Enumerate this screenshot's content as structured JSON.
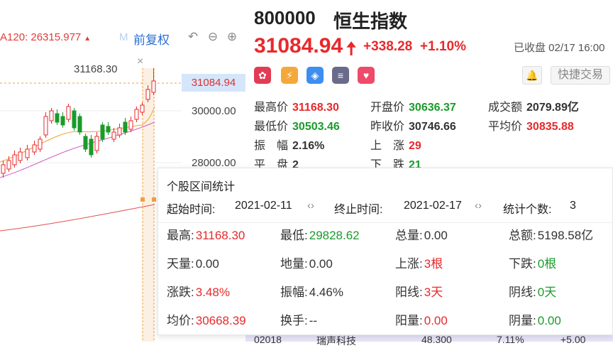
{
  "chart": {
    "ma_label": "A120: 26315.977",
    "ma_arrow": "▲",
    "ma_m": "M",
    "fuquan": "前复权",
    "high_label": "31168.30",
    "current_tag": "31084.94",
    "axis_labels": [
      "30000.00",
      "28000.00"
    ],
    "close_icon": "×",
    "tool_icons": [
      "undo-icon",
      "zoom-out-icon",
      "zoom-in-icon"
    ]
  },
  "info": {
    "code": "800000",
    "name": "恒生指数",
    "price": "31084.94",
    "change": "+338.28",
    "change_pct": "+1.10%",
    "status": "已收盘 02/17 16:00",
    "quick_trade": "快捷交易",
    "badge_colors": [
      "#e23b54",
      "#f4a83a",
      "#3d8ef0",
      "#6a6a8a",
      "#ee4a6a"
    ],
    "stats": [
      {
        "label": "最高价",
        "value": "31168.30",
        "color": "red"
      },
      {
        "label": "开盘价",
        "value": "30636.37",
        "color": "green"
      },
      {
        "label": "成交额",
        "value": "2079.89亿",
        "color": "dark"
      },
      {
        "label": "最低价",
        "value": "30503.46",
        "color": "green"
      },
      {
        "label": "昨收价",
        "value": "30746.66",
        "color": "dark"
      },
      {
        "label": "平均价",
        "value": "30835.88",
        "color": "red"
      },
      {
        "label": "振　幅",
        "value": "2.16%",
        "color": "dark"
      },
      {
        "label": "上　涨",
        "value": "29",
        "color": "red"
      },
      {
        "label": "平　盘",
        "value": "2",
        "color": "dark"
      },
      {
        "label": "下　跌",
        "value": "21",
        "color": "green"
      }
    ]
  },
  "popup": {
    "title": "个股区间统计",
    "start_label": "起始时间:",
    "start_value": "2021-02-11",
    "end_label": "终止时间:",
    "end_value": "2021-02-17",
    "count_label": "统计个数:",
    "count_value": "3",
    "cells": [
      {
        "label": "最高:",
        "value": "31168.30",
        "color": "red"
      },
      {
        "label": "最低:",
        "value": "29828.62",
        "color": "green"
      },
      {
        "label": "总量:",
        "value": "0.00",
        "color": "dark"
      },
      {
        "label": "总额:",
        "value": "5198.58亿",
        "color": "dark"
      },
      {
        "label": "天量:",
        "value": "0.00",
        "color": "dark"
      },
      {
        "label": "地量:",
        "value": "0.00",
        "color": "dark"
      },
      {
        "label": "上涨:",
        "value": "3根",
        "color": "red"
      },
      {
        "label": "下跌:",
        "value": "0根",
        "color": "green"
      },
      {
        "label": "涨跌:",
        "value": "3.48%",
        "color": "red"
      },
      {
        "label": "振幅:",
        "value": "4.46%",
        "color": "dark"
      },
      {
        "label": "阳线:",
        "value": "3天",
        "color": "red"
      },
      {
        "label": "阴线:",
        "value": "0天",
        "color": "green"
      },
      {
        "label": "均价:",
        "value": "30668.39",
        "color": "red"
      },
      {
        "label": "换手:",
        "value": "--",
        "color": "dark"
      },
      {
        "label": "阳量:",
        "value": "0.00",
        "color": "red"
      },
      {
        "label": "阴量:",
        "value": "0.00",
        "color": "green"
      }
    ]
  },
  "bottom": {
    "code": "02018",
    "name": "瑞声科技",
    "price": "48.300",
    "pct": "7.11%",
    "chg": "+5.00"
  }
}
